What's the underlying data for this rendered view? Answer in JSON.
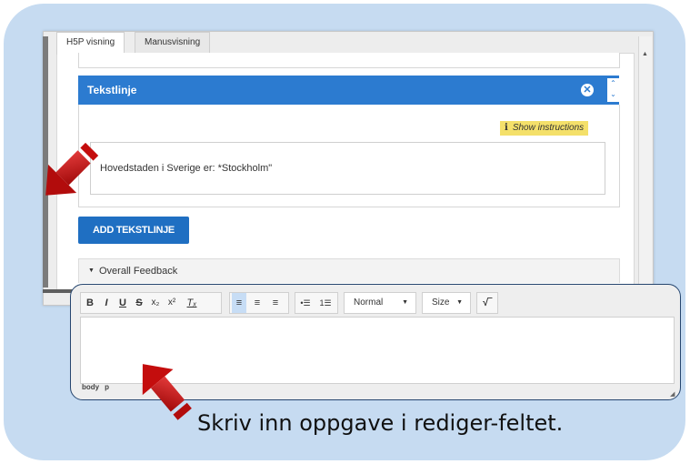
{
  "tabs": [
    {
      "label": "H5P visning",
      "active": true
    },
    {
      "label": "Manusvisning",
      "active": false
    }
  ],
  "panel": {
    "title": "Tekstlinje",
    "close_icon": "close-circle-icon",
    "instructions_label": "Show instructions",
    "instructions_icon": "i",
    "textline_value": "Hovedstaden i Sverige er: *Stockholm\""
  },
  "add_button_label": "ADD TEKSTLINJE",
  "feedback": {
    "label": "Overall Feedback",
    "icon": "caret-down-icon"
  },
  "editor": {
    "toolbar": {
      "bold": "B",
      "italic": "I",
      "underline": "U",
      "strike": "S",
      "subscript": "x₂",
      "superscript": "x²",
      "clear_format": "Tₓ",
      "format_select": "Normal",
      "size_select": "Size",
      "math": "√‾"
    },
    "path": [
      "body",
      "p"
    ],
    "content": ""
  },
  "caption": "Skriv inn oppgave i rediger-feltet.",
  "colors": {
    "frame": "#c6dbf1",
    "panel_header": "#2c7bd0",
    "button": "#1f6fc2",
    "instructions": "#f4e06a",
    "arrow": "#c40d0d",
    "callout_border": "#26466f"
  }
}
